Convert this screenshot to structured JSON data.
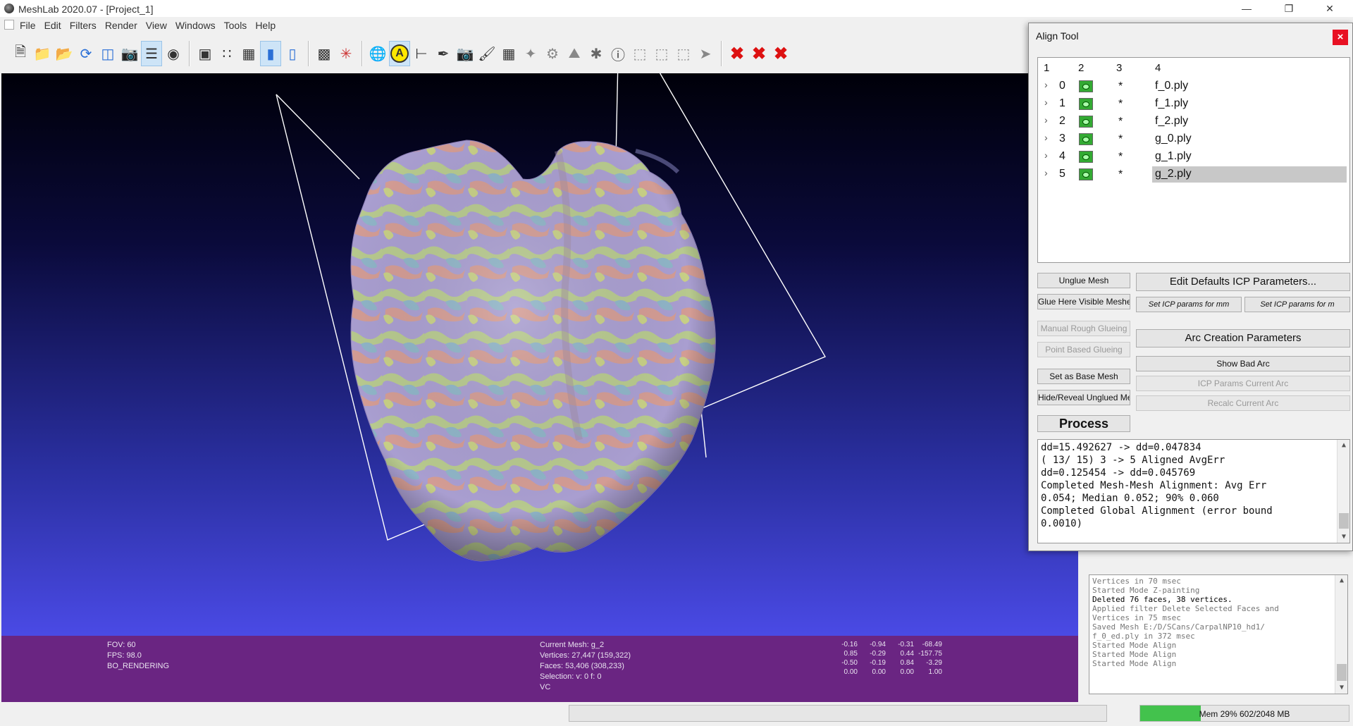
{
  "window": {
    "title": "MeshLab 2020.07 - [Project_1]"
  },
  "menubar": {
    "items": [
      "File",
      "Edit",
      "Filters",
      "Render",
      "View",
      "Windows",
      "Tools",
      "Help"
    ]
  },
  "toolbar": {
    "icons": [
      "new-project-icon",
      "open-project-icon",
      "import-mesh-icon",
      "reload-icon",
      "export-mesh-icon",
      "snapshot-icon",
      "layers-icon",
      "wireframe-sphere-icon",
      "bounding-box-icon",
      "points-icon",
      "wireframe-icon",
      "flat-shading-icon",
      "smooth-shading-icon",
      "measure-icon",
      "axis-icon",
      "trackball-icon",
      "align-icon",
      "axes-icon",
      "select-paint-icon",
      "camera-icon",
      "brush-icon",
      "pickpoint-icon",
      "vertex-select-icon",
      "manipulator-icon",
      "raster-icon",
      "georef-icon",
      "info-icon",
      "select-faces-icon",
      "select-connected-icon",
      "select-area-icon",
      "select-vertex-icon",
      "delete-selected-icon",
      "delete-faces-icon",
      "delete-vertices-icon"
    ]
  },
  "info": {
    "fov": "FOV: 60",
    "fps": "FPS:    98.0",
    "rendering": "BO_RENDERING",
    "current_mesh": "Current Mesh: g_2",
    "vertices": "Vertices: 27,447    (159,322)",
    "faces": "Faces: 53,406    (308,233)",
    "selection": "Selection: v: 0 f: 0",
    "vc": "VC",
    "matrix": [
      [
        "-0.16",
        "-0.94",
        "-0.31",
        "-68.49"
      ],
      [
        "0.85",
        "-0.29",
        "0.44",
        "-157.75"
      ],
      [
        "-0.50",
        "-0.19",
        "0.84",
        "-3.29"
      ],
      [
        "0.00",
        "0.00",
        "0.00",
        "1.00"
      ]
    ]
  },
  "align_tool": {
    "title": "Align Tool",
    "columns": [
      "1",
      "2",
      "3",
      "4"
    ],
    "meshes": [
      {
        "index": "0",
        "mark": "*",
        "name": "f_0.ply"
      },
      {
        "index": "1",
        "mark": "*",
        "name": "f_1.ply"
      },
      {
        "index": "2",
        "mark": "*",
        "name": "f_2.ply"
      },
      {
        "index": "3",
        "mark": "*",
        "name": "g_0.ply"
      },
      {
        "index": "4",
        "mark": "*",
        "name": "g_1.ply"
      },
      {
        "index": "5",
        "mark": "*",
        "name": "g_2.ply"
      }
    ],
    "buttons": {
      "unglue": "Unglue Mesh",
      "glue_visible": "Glue Here Visible Meshes",
      "manual_rough": "Manual Rough Glueing",
      "point_based": "Point Based Glueing",
      "set_base": "Set as Base Mesh",
      "hide_reveal": "Hide/Reveal Unglued Mesh",
      "process": "Process",
      "edit_defaults_icp": "Edit Defaults ICP Parameters...",
      "icp_mm": "Set ICP params for mm",
      "icp_m": "Set ICP params for m",
      "arc_creation": "Arc Creation Parameters",
      "show_bad_arc": "Show Bad Arc",
      "icp_current_arc": "ICP Params Current Arc",
      "recalc_arc": "Recalc Current Arc"
    },
    "log": [
      "dd=15.492627 -> dd=0.047834",
      "( 13/ 15)  3 ->  5 Aligned AvgErr",
      "dd=0.125454 -> dd=0.045769",
      "Completed Mesh-Mesh Alignment: Avg Err",
      "0.054; Median 0.052; 90% 0.060",
      "Completed Global Alignment (error bound",
      "0.0010)"
    ]
  },
  "main_log": [
    "Vertices in 70 msec",
    "Started Mode Z-painting",
    "Deleted 76 faces, 38 vertices.",
    "Applied filter Delete Selected Faces and",
    "Vertices in 75 msec",
    "Saved Mesh E:/D/SCans/CarpalNP10_hd1/",
    "f_0_ed.ply in 372 msec",
    "Started Mode Align",
    "Started Mode Align",
    "Started Mode Align"
  ],
  "status": {
    "memory": "Mem 29% 602/2048 MB",
    "memory_fraction": 0.29
  }
}
